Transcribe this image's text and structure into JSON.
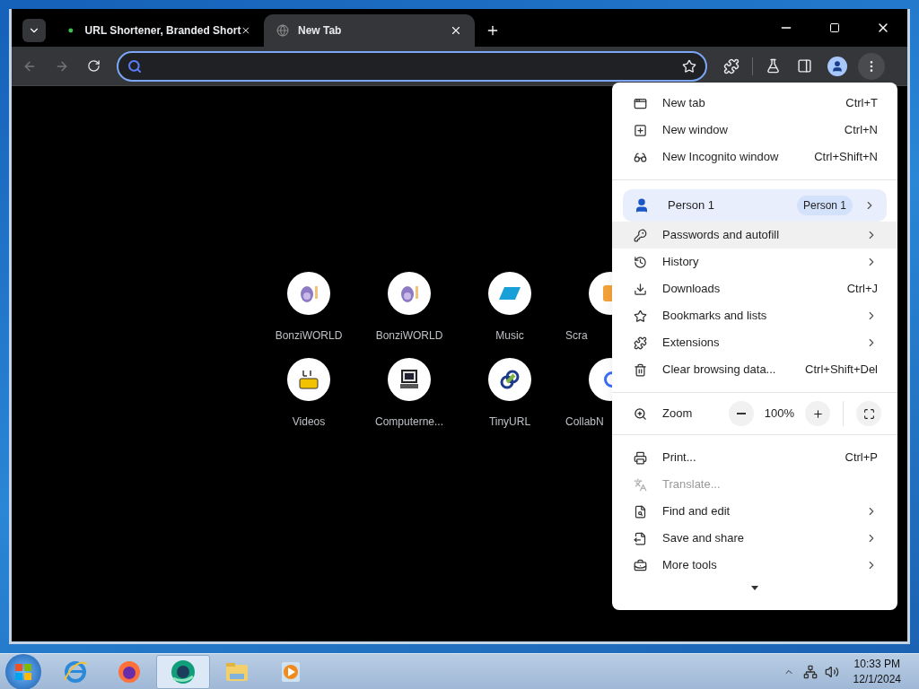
{
  "tabs": [
    {
      "title": "URL Shortener, Branded Short",
      "selected": false
    },
    {
      "title": "New Tab",
      "selected": true
    }
  ],
  "shortcuts": [
    {
      "label": "BonziWORLD",
      "kind": "monkey"
    },
    {
      "label": "BonziWORLD",
      "kind": "monkey"
    },
    {
      "label": "Music",
      "kind": "slant"
    },
    {
      "label": "Scra",
      "kind": "orange"
    },
    {
      "label": "Videos",
      "kind": "tube"
    },
    {
      "label": "Computerne...",
      "kind": "computer"
    },
    {
      "label": "TinyURL",
      "kind": "link"
    },
    {
      "label": "CollabN",
      "kind": "ring"
    }
  ],
  "menu": {
    "items": [
      {
        "kind": "item",
        "label": "New tab",
        "shortcut": "Ctrl+T",
        "submenu": false,
        "hovered": false,
        "disabled": false
      },
      {
        "kind": "item",
        "label": "New window",
        "shortcut": "Ctrl+N",
        "submenu": false,
        "hovered": false,
        "disabled": false
      },
      {
        "kind": "item",
        "label": "New Incognito window",
        "shortcut": "Ctrl+Shift+N",
        "submenu": false,
        "hovered": false,
        "disabled": false
      },
      {
        "kind": "separator"
      },
      {
        "kind": "profile",
        "label": "Person 1",
        "badge": "Person 1"
      },
      {
        "kind": "item",
        "label": "Passwords and autofill",
        "submenu": true,
        "hovered": true,
        "disabled": false
      },
      {
        "kind": "item",
        "label": "History",
        "submenu": true,
        "hovered": false,
        "disabled": false
      },
      {
        "kind": "item",
        "label": "Downloads",
        "shortcut": "Ctrl+J",
        "submenu": false,
        "hovered": false,
        "disabled": false
      },
      {
        "kind": "item",
        "label": "Bookmarks and lists",
        "submenu": true,
        "hovered": false,
        "disabled": false
      },
      {
        "kind": "item",
        "label": "Extensions",
        "submenu": true,
        "hovered": false,
        "disabled": false
      },
      {
        "kind": "item",
        "label": "Clear browsing data...",
        "shortcut": "Ctrl+Shift+Del",
        "submenu": false,
        "hovered": false,
        "disabled": false
      },
      {
        "kind": "separator"
      },
      {
        "kind": "zoom",
        "label": "Zoom",
        "value": "100%"
      },
      {
        "kind": "separator"
      },
      {
        "kind": "item",
        "label": "Print...",
        "shortcut": "Ctrl+P",
        "submenu": false,
        "hovered": false,
        "disabled": false
      },
      {
        "kind": "item",
        "label": "Translate...",
        "submenu": false,
        "hovered": false,
        "disabled": true
      },
      {
        "kind": "item",
        "label": "Find and edit",
        "submenu": true,
        "hovered": false,
        "disabled": false
      },
      {
        "kind": "item",
        "label": "Save and share",
        "submenu": true,
        "hovered": false,
        "disabled": false
      },
      {
        "kind": "item",
        "label": "More tools",
        "submenu": true,
        "hovered": false,
        "disabled": false
      }
    ]
  },
  "taskbar": {
    "apps": [
      {
        "kind": "ie",
        "selected": false
      },
      {
        "kind": "firefox",
        "selected": false
      },
      {
        "kind": "browser",
        "selected": true
      },
      {
        "kind": "folder",
        "selected": false
      },
      {
        "kind": "media",
        "selected": false
      }
    ],
    "time": "10:33 PM",
    "date": "12/1/2024"
  }
}
